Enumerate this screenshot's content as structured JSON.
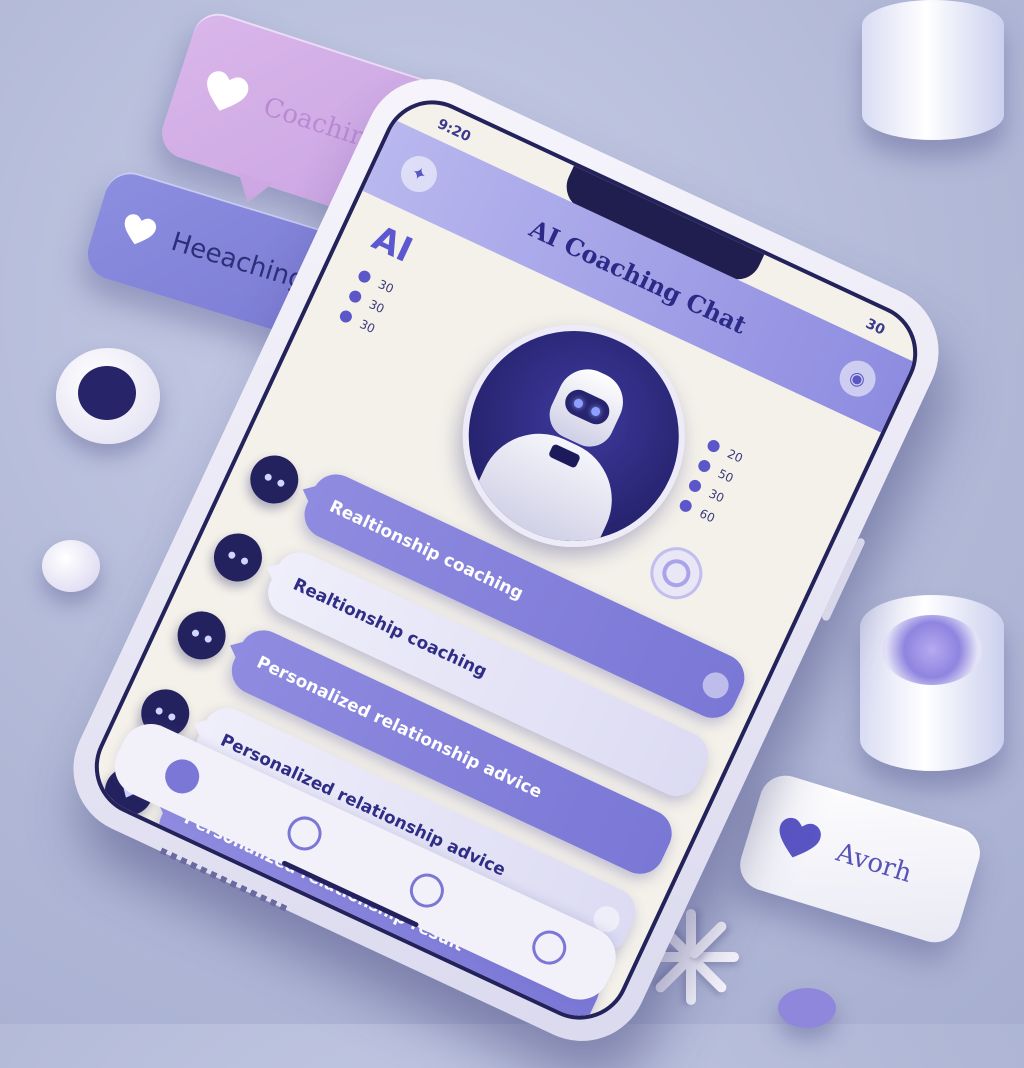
{
  "colors": {
    "background": "#b8bfdc",
    "accent": "#7b77d6",
    "header": "#8e8ce0",
    "dark": "#24215f",
    "pink": "#d3aee7"
  },
  "floating": {
    "coaching_pill": {
      "label": "Coaching",
      "icon": "heart-icon"
    },
    "heartbeat_pill": {
      "label": "Heeaching",
      "icon": "heart-icon"
    },
    "bottom_pill": {
      "label": "Avorh",
      "icon": "heart-icon"
    }
  },
  "phone": {
    "status": {
      "time": "9:20",
      "battery": "30"
    },
    "header": {
      "title": "AI Coaching Chat",
      "left_icon": "chat-icon",
      "right_icon": "profile-icon"
    },
    "ai_label": "AI",
    "left_stats": [
      "30",
      "30",
      "30"
    ],
    "right_stats": [
      "20",
      "50",
      "30",
      "60"
    ],
    "messages": [
      {
        "title": "Realtionship coaching",
        "subtitle": "",
        "style": "accent"
      },
      {
        "title": "Realtionship coaching",
        "subtitle": "",
        "style": "light"
      },
      {
        "title": "Personalized relationship advice",
        "subtitle": "",
        "style": "accent"
      },
      {
        "title": "Personalized relationship advice",
        "subtitle": "",
        "style": "light"
      },
      {
        "title": "Personalized relationship result",
        "subtitle": "",
        "style": "accent"
      }
    ],
    "tabbar": [
      "home-icon",
      "chat-icon",
      "heart-icon",
      "settings-icon"
    ]
  }
}
